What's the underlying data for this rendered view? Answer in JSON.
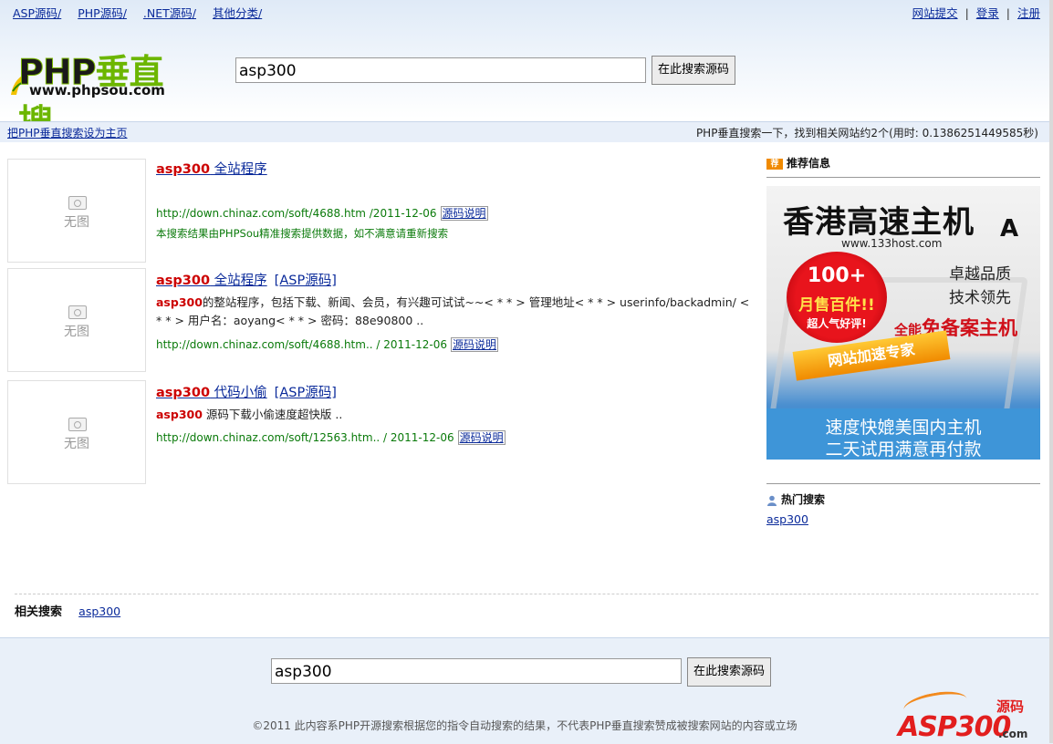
{
  "top_nav": [
    "ASP源码/",
    "PHP源码/",
    ".NET源码/",
    "其他分类/"
  ],
  "user_nav": {
    "submit": "网站提交",
    "sep": "|",
    "login": "登录",
    "register": "注册"
  },
  "logo": {
    "main": "PHP",
    "cn": "垂直搜",
    "url": "www.phpsou.com"
  },
  "search": {
    "query": "asp300",
    "button": "在此搜索源码"
  },
  "strip": {
    "set_home": "把PHP垂直搜索设为主页",
    "stats": "PHP垂直搜索一下，找到相关网站约2个(用时: 0.1386251449585秒)"
  },
  "no_image": "无图",
  "results": [
    {
      "kw": "asp300",
      "title_rest": " 全站程序",
      "tag": "",
      "desc_kw": "",
      "desc": "",
      "url": "http://down.chinaz.com/soft/4688.htm /2011-12-06",
      "src": "源码说明",
      "note": "本搜索结果由PHPSou精准搜索提供数据，如不满意请重新搜索"
    },
    {
      "kw": "asp300",
      "title_rest": " 全站程序",
      "tag": "[ASP源码]",
      "desc_kw": "asp300",
      "desc": "的整站程序，包括下载、新闻、会员，有兴趣可试试~~< * * > 管理地址< * * > userinfo/backadmin/ < * * > 用户名：aoyang< * * > 密码：88e90800 ..",
      "url": "http://down.chinaz.com/soft/4688.htm.. / 2011-12-06",
      "src": "源码说明",
      "note": ""
    },
    {
      "kw": "asp300",
      "title_rest": " 代码小偷",
      "tag": "[ASP源码]",
      "desc_kw": "asp300",
      "desc": " 源码下载小偷速度超快版 ..",
      "url": "http://down.chinaz.com/soft/12563.htm.. / 2011-12-06",
      "src": "源码说明",
      "note": ""
    }
  ],
  "sidebar": {
    "recommend_title": "推荐信息",
    "recommend_icon": "荐",
    "ad": {
      "title": "香港高速主机",
      "site": "www.133host.com",
      "logo": "A",
      "badge1": "100+",
      "badge2": "月售百件!!",
      "badge3": "超人气好评!",
      "q1": "卓越品质",
      "q2": "技术领先",
      "q3_pre": "全能",
      "q3": "免备案主机",
      "speed": "网站加速专家",
      "f1": "速度快媲美国内主机",
      "f2": "二天试用满意再付款"
    },
    "hot_title": "热门搜索",
    "hot_items": [
      "asp300"
    ]
  },
  "related": {
    "label": "相关搜索",
    "items": [
      "asp300"
    ]
  },
  "copyright": "©2011 此内容系PHP开源搜索根据您的指令自动搜索的结果，不代表PHP垂直搜索赞成被搜索网站的内容或立场",
  "watermark": {
    "text": "ASP300",
    "cn": "源码",
    "com": ".com"
  }
}
